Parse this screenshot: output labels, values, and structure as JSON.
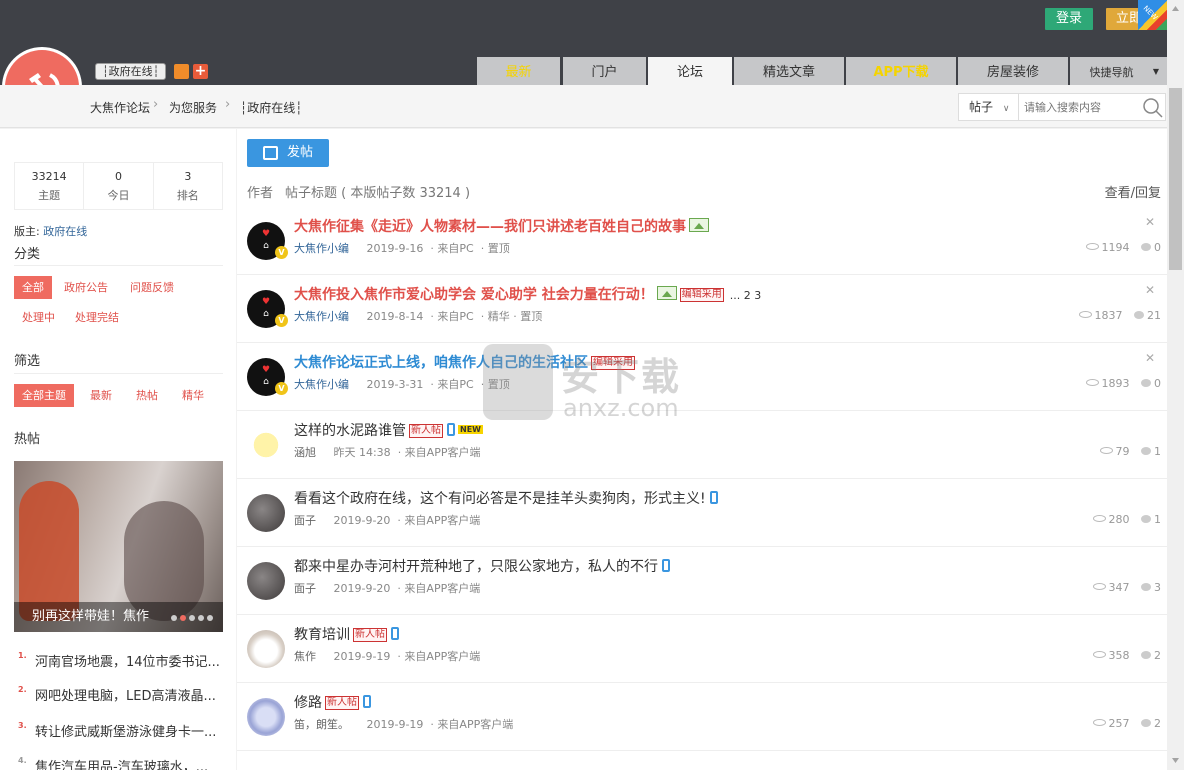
{
  "header": {
    "login_label": "登录",
    "register_label": "立即",
    "new_badge": "NEW",
    "forum_chip": "┆政府在线┆",
    "tabs": [
      {
        "label": "最新",
        "style": "yellow"
      },
      {
        "label": "门户",
        "style": ""
      },
      {
        "label": "论坛",
        "style": "active"
      },
      {
        "label": "精选文章",
        "style": ""
      },
      {
        "label": "APP下载",
        "style": "yellow"
      },
      {
        "label": "房屋装修",
        "style": ""
      },
      {
        "label": "快捷导航",
        "style": "quick"
      }
    ]
  },
  "breadcrumb": [
    "大焦作论坛",
    "为您服务",
    "┆政府在线┆"
  ],
  "search": {
    "scope": "帖子",
    "placeholder": "请输入搜索内容"
  },
  "sidebar": {
    "stats": [
      {
        "num": "33214",
        "label": "主题"
      },
      {
        "num": "0",
        "label": "今日"
      },
      {
        "num": "3",
        "label": "排名"
      }
    ],
    "moderator_label": "版主:",
    "moderator_name": "政府在线",
    "category_heading": "分类",
    "categories": [
      "全部",
      "政府公告",
      "问题反馈",
      "处理中",
      "处理完结"
    ],
    "filter_heading": "筛选",
    "filters": [
      "全部主题",
      "最新",
      "热帖",
      "精华"
    ],
    "hot_heading": "热帖",
    "hot_caption": "别再这样带娃！焦作",
    "hot_list": [
      {
        "num": "1.",
        "text": "河南官场地震，14位市委书记..."
      },
      {
        "num": "2.",
        "text": "网吧处理电脑，LED高清液晶..."
      },
      {
        "num": "3.",
        "text": "转让修武威斯堡游泳健身卡一..."
      },
      {
        "num": "4.",
        "text": "焦作汽车用品-汽车玻璃水，..."
      }
    ]
  },
  "main": {
    "post_button": "发帖",
    "col_author": "作者",
    "col_title": "帖子标题 ( 本版帖子数 33214 )",
    "col_views": "查看/回复",
    "threads": [
      {
        "title": "大焦作征集《走近》人物素材——我们只讲述老百姓自己的故事",
        "style": "red",
        "author": "大焦作小编",
        "date": "2019-9-16",
        "source": "· 来自PC",
        "extra": "· 置顶",
        "views": "1194",
        "replies": "0",
        "avatar": "ilove",
        "img": true,
        "tag": "",
        "pages": "",
        "phone": false,
        "newflag": false
      },
      {
        "title": "大焦作投入焦作市爱心助学会 爱心助学 社会力量在行动！",
        "style": "red",
        "author": "大焦作小编",
        "date": "2019-8-14",
        "source": "· 来自PC",
        "extra": "· 精华 · 置顶",
        "views": "1837",
        "replies": "21",
        "avatar": "ilove",
        "img": true,
        "tag": "编辑采用",
        "pages": "... 2  3",
        "phone": false,
        "newflag": false
      },
      {
        "title": "大焦作论坛正式上线，咱焦作人自己的生活社区",
        "style": "blue",
        "author": "大焦作小编",
        "date": "2019-3-31",
        "source": "· 来自PC",
        "extra": "· 置顶",
        "views": "1893",
        "replies": "0",
        "avatar": "ilove",
        "img": false,
        "tag": "编辑采用",
        "pages": "",
        "phone": false,
        "newflag": false
      },
      {
        "title": "这样的水泥路谁管",
        "style": "plain",
        "author": "涵旭",
        "date": "昨天 14:38",
        "source": "· 来自APP客户端",
        "extra": "",
        "views": "79",
        "replies": "1",
        "avatar": "chick",
        "img": false,
        "tag": "新人帖",
        "pages": "",
        "phone": true,
        "newflag": true
      },
      {
        "title": "看看这个政府在线，这个有问必答是不是挂羊头卖狗肉，形式主义!",
        "style": "plain",
        "author": "面子",
        "date": "2019-9-20",
        "source": "· 来自APP客户端",
        "extra": "",
        "views": "280",
        "replies": "1",
        "avatar": "dark",
        "img": false,
        "tag": "",
        "pages": "",
        "phone": true,
        "newflag": false
      },
      {
        "title": "都来中星办寺河村开荒种地了，只限公家地方，私人的不行",
        "style": "plain",
        "author": "面子",
        "date": "2019-9-20",
        "source": "· 来自APP客户端",
        "extra": "",
        "views": "347",
        "replies": "3",
        "avatar": "dark",
        "img": false,
        "tag": "",
        "pages": "",
        "phone": true,
        "newflag": false
      },
      {
        "title": "教育培训",
        "style": "plain",
        "author": "焦作",
        "date": "2019-9-19",
        "source": "· 来自APP客户端",
        "extra": "",
        "views": "358",
        "replies": "2",
        "avatar": "cat",
        "img": false,
        "tag": "新人帖",
        "pages": "",
        "phone": true,
        "newflag": false
      },
      {
        "title": "修路",
        "style": "plain",
        "author": "笛，朗笙。",
        "date": "2019-9-19",
        "source": "· 来自APP客户端",
        "extra": "",
        "views": "257",
        "replies": "2",
        "avatar": "anime",
        "img": false,
        "tag": "新人帖",
        "pages": "",
        "phone": true,
        "newflag": false
      }
    ]
  },
  "watermark": {
    "cn": "安下载",
    "en": "anxz.com"
  },
  "colors": {
    "accent_red": "#ef6b60",
    "link_blue": "#2e8bd3",
    "login_green": "#2ea877",
    "post_blue": "#3a96e0"
  }
}
